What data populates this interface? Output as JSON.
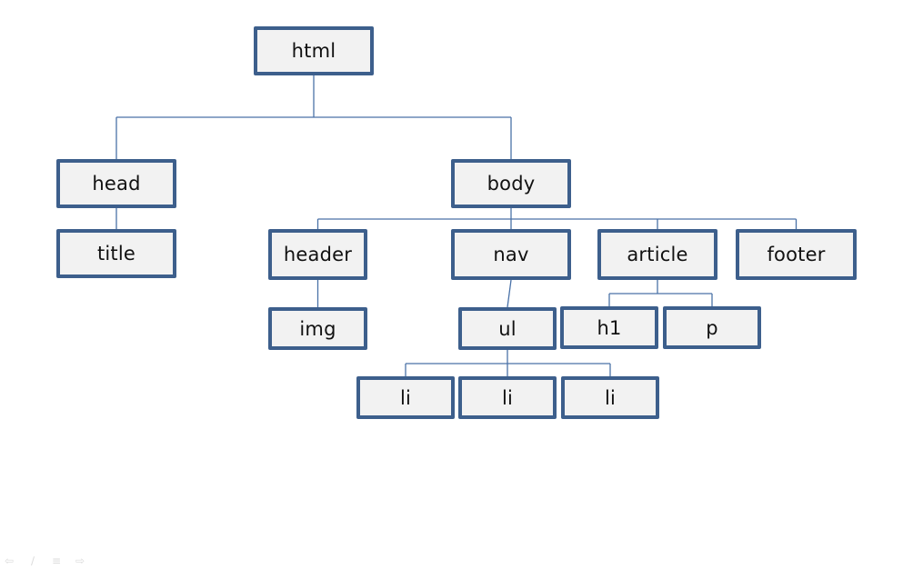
{
  "diagram": {
    "type": "tree",
    "nodes": [
      {
        "id": "html",
        "label": "html"
      },
      {
        "id": "head",
        "label": "head"
      },
      {
        "id": "body",
        "label": "body"
      },
      {
        "id": "title",
        "label": "title"
      },
      {
        "id": "header",
        "label": "header"
      },
      {
        "id": "nav",
        "label": "nav"
      },
      {
        "id": "article",
        "label": "article"
      },
      {
        "id": "footer",
        "label": "footer"
      },
      {
        "id": "img",
        "label": "img"
      },
      {
        "id": "ul",
        "label": "ul"
      },
      {
        "id": "h1",
        "label": "h1"
      },
      {
        "id": "p",
        "label": "p"
      },
      {
        "id": "li1",
        "label": "li"
      },
      {
        "id": "li2",
        "label": "li"
      },
      {
        "id": "li3",
        "label": "li"
      }
    ],
    "edges": [
      [
        "html",
        "head"
      ],
      [
        "html",
        "body"
      ],
      [
        "head",
        "title"
      ],
      [
        "body",
        "header"
      ],
      [
        "body",
        "nav"
      ],
      [
        "body",
        "article"
      ],
      [
        "body",
        "footer"
      ],
      [
        "header",
        "img"
      ],
      [
        "nav",
        "ul"
      ],
      [
        "article",
        "h1"
      ],
      [
        "article",
        "p"
      ],
      [
        "ul",
        "li1"
      ],
      [
        "ul",
        "li2"
      ],
      [
        "ul",
        "li3"
      ]
    ],
    "colors": {
      "box_border": "#3d5f8c",
      "box_fill": "#f2f2f2",
      "connector": "#4a72a8",
      "text": "#111111"
    }
  },
  "slide_toolbar": {
    "icons": [
      "back-arrow-icon",
      "pen-icon",
      "menu-icon",
      "forward-arrow-icon"
    ]
  }
}
